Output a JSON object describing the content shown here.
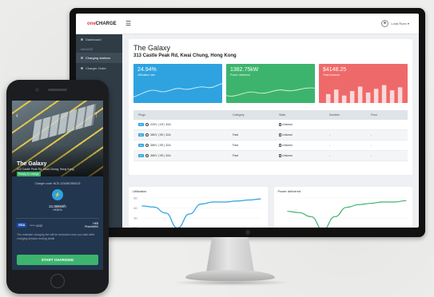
{
  "app": {
    "brand_one": "one",
    "brand_rest": "CHARGE",
    "menu_icon": "hamburger-icon",
    "user_name": "Lorai Ruen ▾"
  },
  "sidebar": {
    "items": [
      {
        "label": "Dashboard",
        "active": false
      },
      {
        "label": "Charging stations",
        "active": true
      },
      {
        "label": "Charger Order",
        "active": false
      }
    ],
    "section_label": "MANAGE"
  },
  "site": {
    "title": "The Galaxy",
    "address": "313 Castle Peak Rd, Kwai Chung, Hong Kong"
  },
  "tiles": [
    {
      "value": "24.94%",
      "label": "Utilization rate",
      "color": "#2ea3e0",
      "kind": "line"
    },
    {
      "value": "1382.75kW",
      "label": "Power delivered",
      "color": "#3db46d",
      "kind": "line"
    },
    {
      "value": "$4148.25",
      "label": "Total revenue",
      "color": "#ee6a6a",
      "kind": "bar"
    }
  ],
  "stations": {
    "headers": [
      "Plugs",
      "Category",
      "State",
      "Number",
      "Floor"
    ],
    "rows": [
      {
        "badge": "AC",
        "plug": "220V | 1Φ | 32A",
        "category": "",
        "state": "Unkown",
        "number": "",
        "floor": ""
      },
      {
        "badge": "AC",
        "plug": "380V | 3Φ | 32A",
        "category": "Fast",
        "state": "Unkown",
        "number": "-",
        "floor": "-"
      },
      {
        "badge": "AC",
        "plug": "380V | 3Φ | 32A",
        "category": "Fast",
        "state": "Unkown",
        "number": "-",
        "floor": "-"
      },
      {
        "badge": "AC",
        "plug": "380V | 3Φ | 32A",
        "category": "Fast",
        "state": "Unkown",
        "number": "-",
        "floor": "-"
      }
    ]
  },
  "charts": {
    "utilization_title": "Utilization",
    "power_title": "Power delivered",
    "utilization_ticks": [
      "50",
      "40",
      "30",
      "20",
      "10"
    ]
  },
  "phone": {
    "title": "The Galaxy",
    "subtitle": "313 Castle Peak Rd, Kwai Chung, Hong Kong",
    "status": "Ready to charge",
    "charger_code": "Charger code: NCE-1234567890123",
    "rate": "21.06kW/h",
    "rate_sub": "HK$0/h",
    "card_brand": "VISA",
    "card_number": "**** 4242",
    "price_line1": "HK$",
    "price_line2": "Price/kW/h",
    "note": "The estimate charging fee will be deducted once you start after charging session ending detail",
    "start_label": "START CHARGING"
  },
  "chart_data": [
    {
      "type": "line",
      "title": "Utilization",
      "x": [
        0,
        1,
        2,
        3,
        4,
        5,
        6,
        7,
        8,
        9,
        10
      ],
      "y": [
        42,
        41,
        35,
        20,
        34,
        44,
        46,
        46,
        47,
        48,
        49
      ],
      "ylim": [
        10,
        50
      ],
      "yticks": [
        10,
        20,
        30,
        40,
        50
      ],
      "color": "#2ea3e0"
    },
    {
      "type": "line",
      "title": "Power delivered",
      "x": [
        0,
        1,
        2,
        3,
        4,
        5,
        6,
        7,
        8,
        9,
        10
      ],
      "y": [
        30,
        29,
        26,
        16,
        26,
        33,
        35,
        36,
        37,
        37,
        38
      ],
      "ylim": [
        10,
        40
      ],
      "color": "#3db46d"
    }
  ]
}
